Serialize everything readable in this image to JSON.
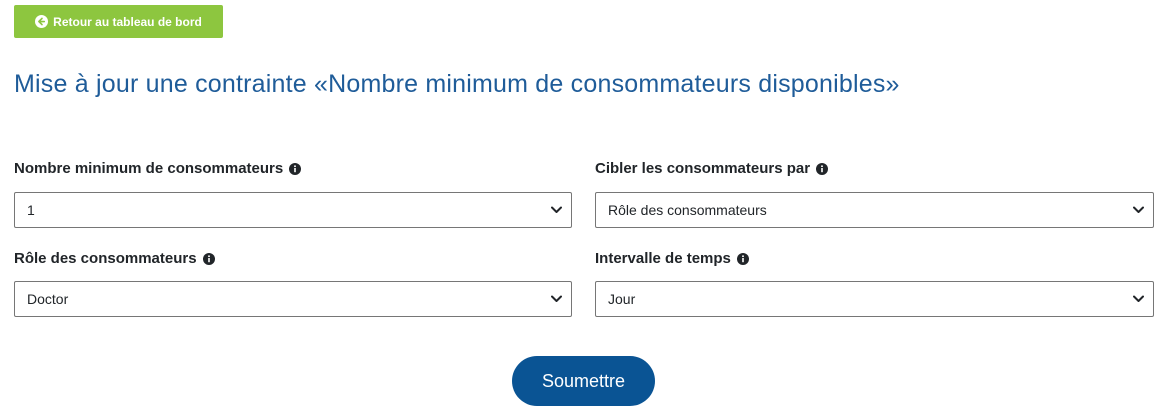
{
  "back_button": {
    "label": "Retour au tableau de bord",
    "icon": "arrow-circle-left-icon"
  },
  "page_title": "Mise à jour une contrainte «Nombre minimum de consommateurs disponibles»",
  "form": {
    "min_consumers": {
      "label": "Nombre minimum de consommateurs",
      "value": "1",
      "info_icon": "info-circle-icon"
    },
    "target_by": {
      "label": "Cibler les consommateurs par",
      "value": "Rôle des consommateurs",
      "info_icon": "info-circle-icon"
    },
    "consumer_role": {
      "label": "Rôle des consommateurs",
      "value": "Doctor",
      "info_icon": "info-circle-icon"
    },
    "time_interval": {
      "label": "Intervalle de temps",
      "value": "Jour",
      "info_icon": "info-circle-icon"
    }
  },
  "submit_button": {
    "label": "Soumettre"
  },
  "colors": {
    "back_button_bg": "#8dc63f",
    "title": "#1f5c99",
    "submit_bg": "#0a5494"
  }
}
